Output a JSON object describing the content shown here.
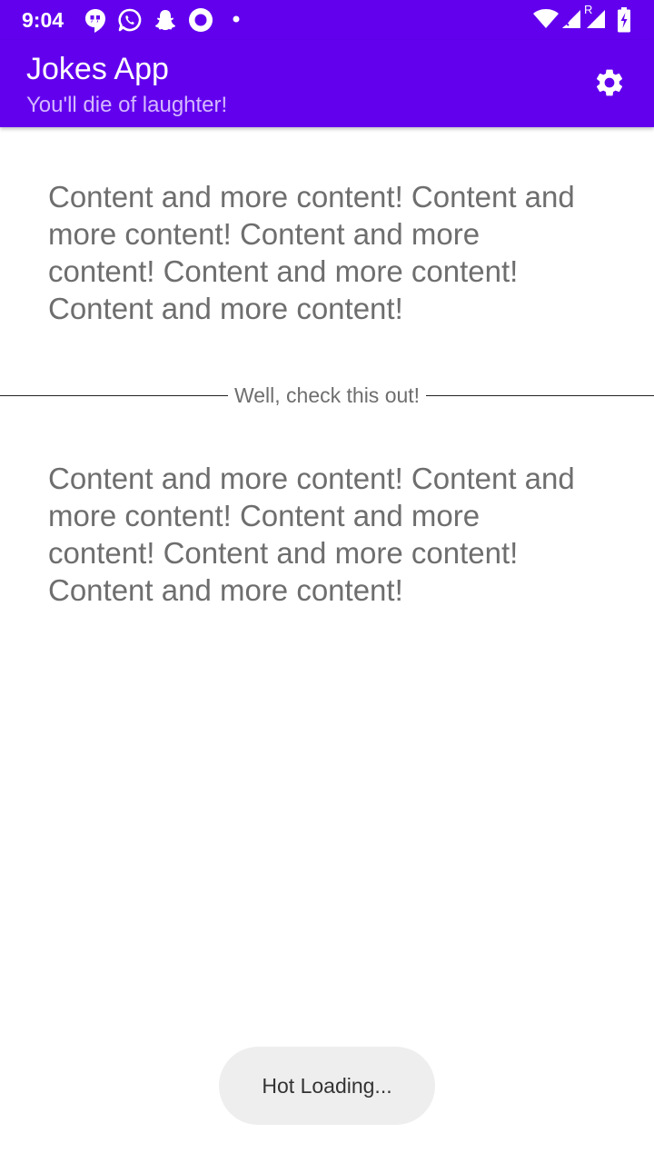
{
  "status_bar": {
    "time": "9:04",
    "left_icons": [
      "hangouts-icon",
      "whatsapp-icon",
      "snapchat-icon",
      "circle-app-icon",
      "notification-dot-icon"
    ],
    "right_icons": [
      "wifi-icon",
      "cell-signal-icon",
      "roaming-signal-icon",
      "battery-charging-icon"
    ],
    "roaming_label": "R"
  },
  "app_bar": {
    "title": "Jokes App",
    "subtitle": "You'll die of laughter!",
    "settings_icon": "gear-icon"
  },
  "main": {
    "content_top": "Content and more content! Content and more content! Content and more content! Content and more content! Content and more content!",
    "divider_label": "Well, check this out!",
    "content_bottom": "Content and more content! Content and more content! Content and more content! Content and more content! Content and more content!"
  },
  "toast": {
    "message": "Hot Loading..."
  },
  "colors": {
    "primary": "#6200ee",
    "subtitle": "#d4b8ff",
    "body_text": "#6e6e6e",
    "toast_bg": "#eeeeee"
  }
}
